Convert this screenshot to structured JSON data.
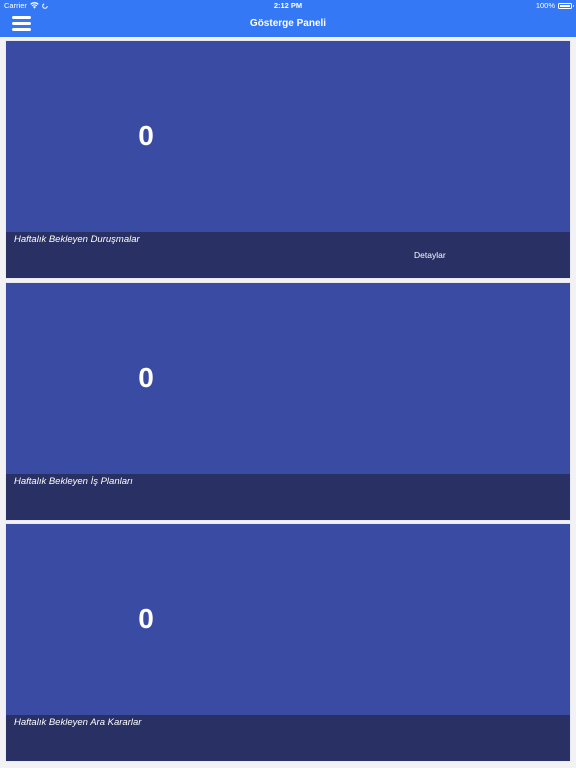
{
  "status_bar": {
    "carrier": "Carrier",
    "time": "2:12 PM",
    "battery_text": "100%",
    "battery_level": 1.0
  },
  "navbar": {
    "title": "Gösterge Paneli"
  },
  "cards": [
    {
      "value": "0",
      "label": "Haftalık Bekleyen Duruşmalar",
      "link": "Detaylar"
    },
    {
      "value": "0",
      "label": "Haftalık Bekleyen İş Planları",
      "link": ""
    },
    {
      "value": "0",
      "label": "Haftalık Bekleyen Ara Kararlar",
      "link": ""
    }
  ]
}
